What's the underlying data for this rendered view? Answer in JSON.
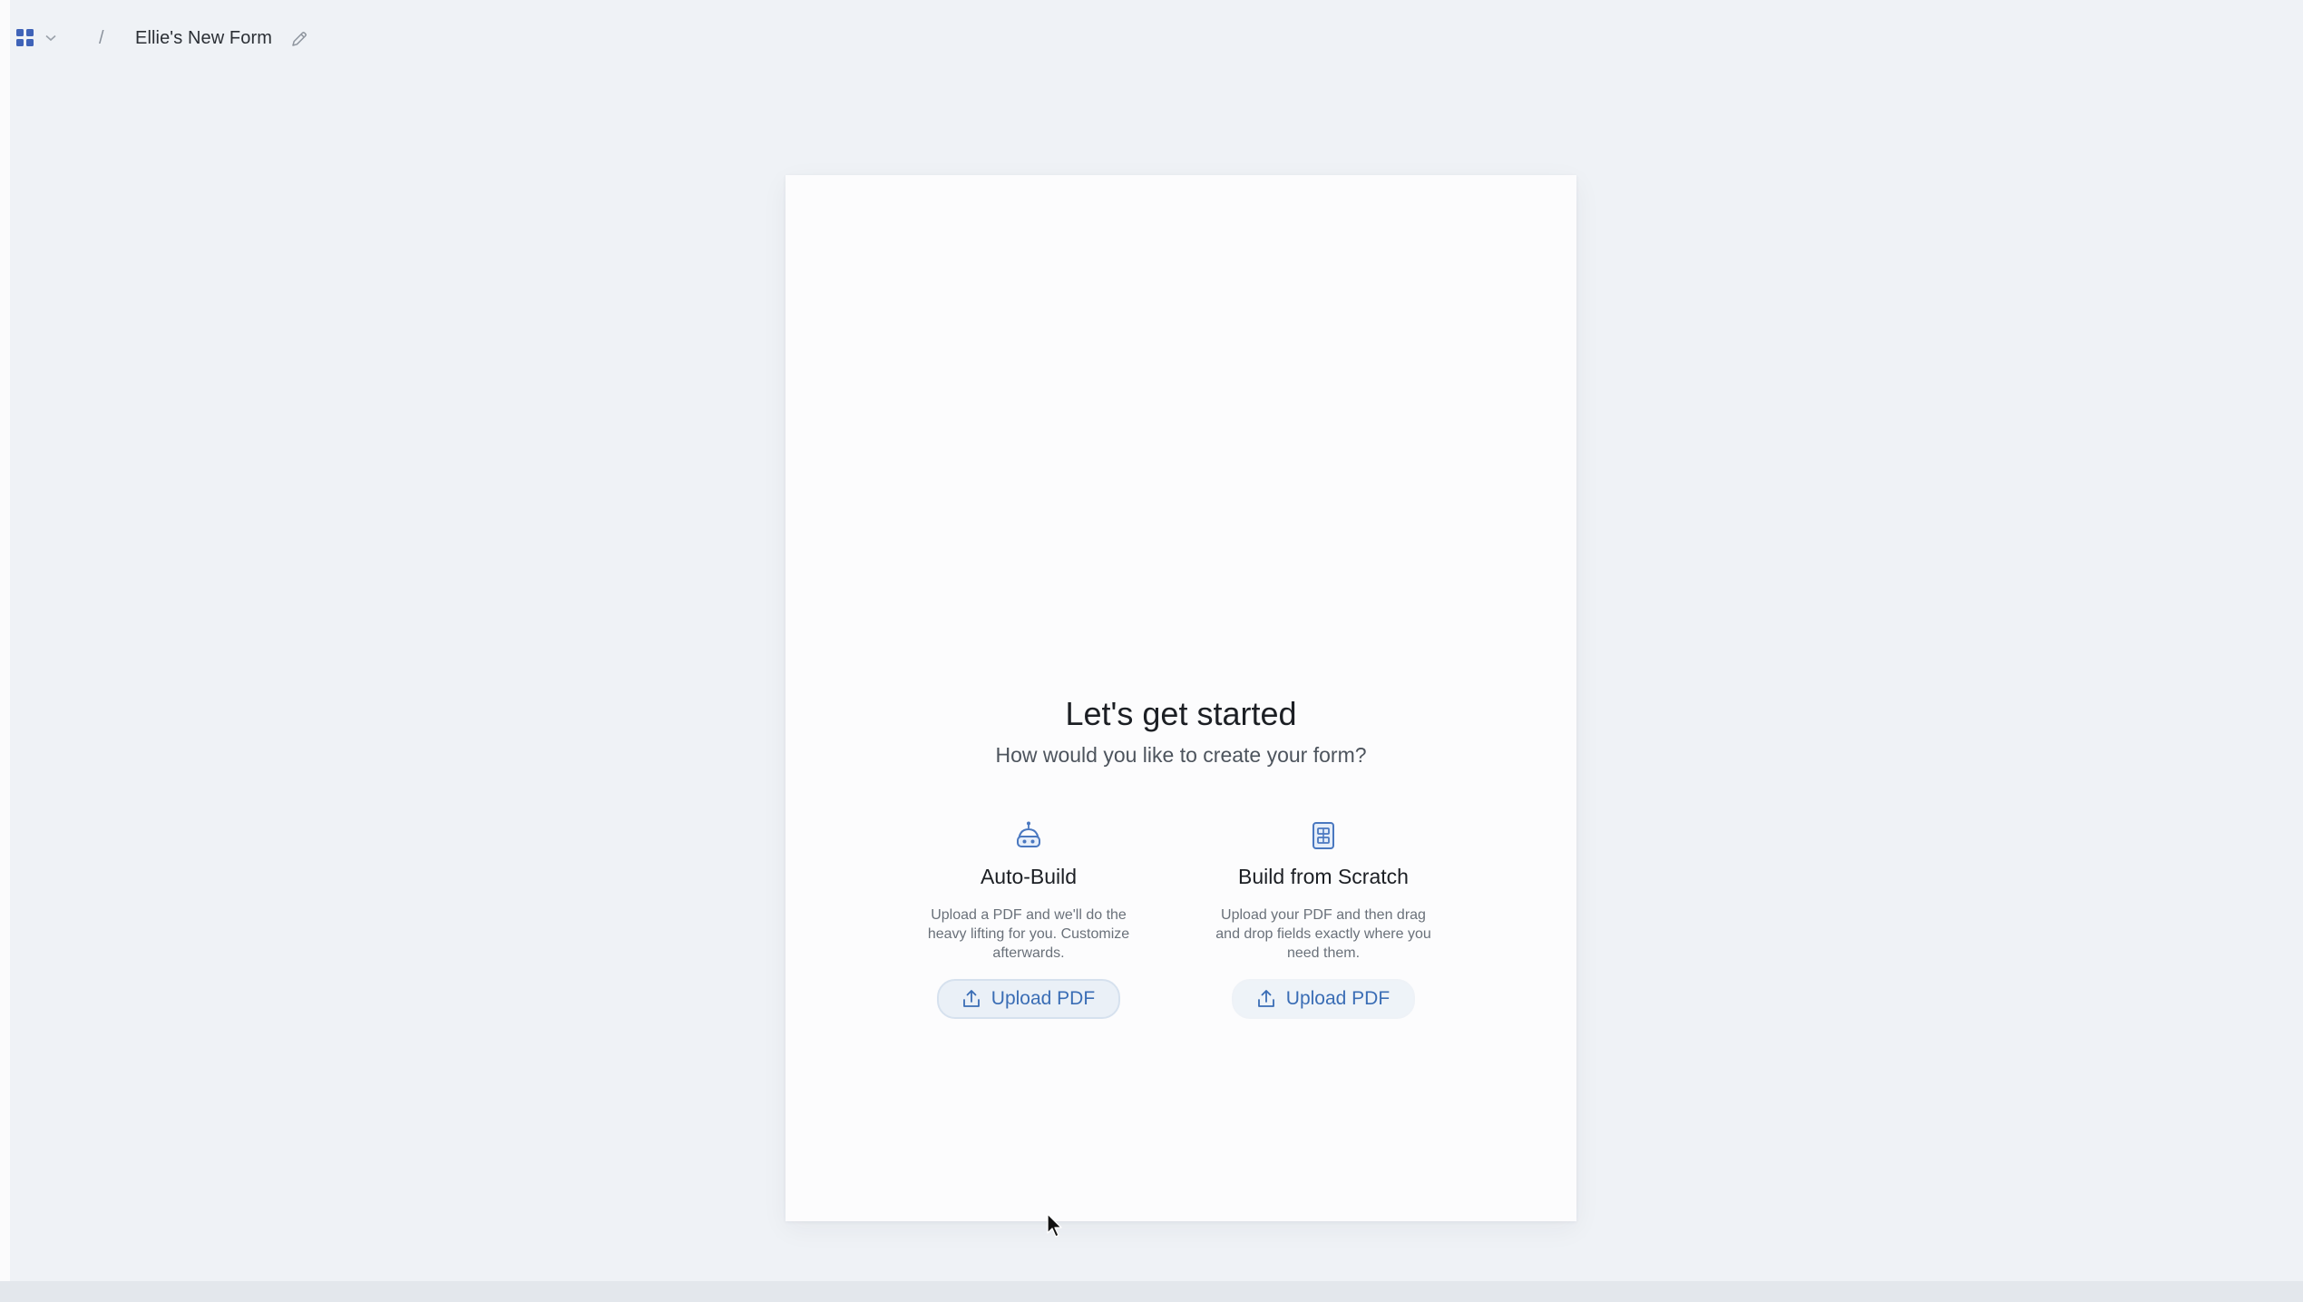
{
  "breadcrumb": {
    "separator": "/",
    "form_title": "Ellie's New Form"
  },
  "start": {
    "heading": "Let's get started",
    "subheading": "How would you like to create your form?"
  },
  "options": [
    {
      "title": "Auto-Build",
      "description": "Upload a PDF and we'll do the heavy lifting for you. Customize afterwards.",
      "button_label": "Upload PDF",
      "icon": "robot-icon"
    },
    {
      "title": "Build from Scratch",
      "description": "Upload your PDF and then drag and drop fields exactly where you need them.",
      "button_label": "Upload PDF",
      "icon": "form-builder-icon"
    }
  ],
  "colors": {
    "accent": "#3a6db5",
    "background": "#eff2f6",
    "paper": "#fcfcfd"
  }
}
